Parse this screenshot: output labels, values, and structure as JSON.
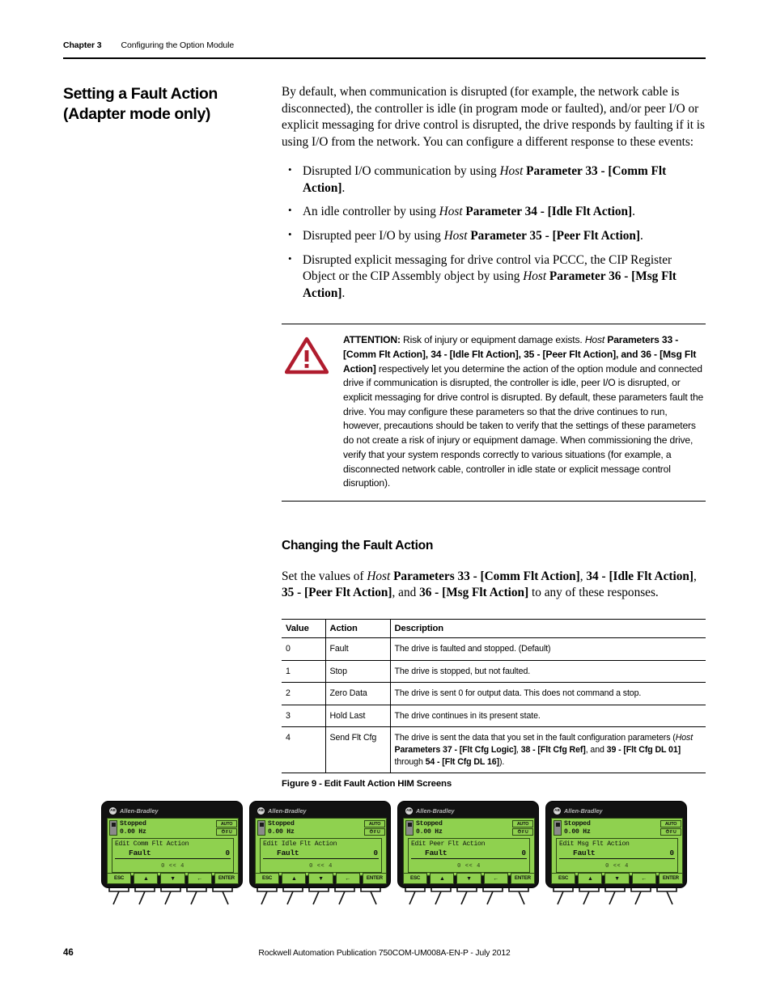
{
  "header": {
    "chapter": "Chapter 3",
    "title": "Configuring the Option Module"
  },
  "section": {
    "title_line1": "Setting a Fault Action",
    "title_line2": "(Adapter mode only)",
    "intro": "By default, when communication is disrupted (for example, the network cable is disconnected), the controller is idle (in program mode or faulted), and/or peer I/O or explicit messaging for drive control is disrupted, the drive responds by faulting if it is using I/O from the network. You can configure a different response to these events:"
  },
  "bullets": [
    {
      "pre": "Disrupted I/O communication by using ",
      "italic": "Host",
      "bold": " Parameter 33 - [Comm Flt Action]",
      "post": "."
    },
    {
      "pre": "An idle controller by using ",
      "italic": "Host",
      "bold": " Parameter 34 - [Idle Flt Action]",
      "post": "."
    },
    {
      "pre": "Disrupted peer I/O by using ",
      "italic": "Host",
      "bold": " Parameter 35 - [Peer Flt Action]",
      "post": "."
    },
    {
      "pre": "Disrupted explicit messaging for drive control via PCCC, the CIP Register Object or the CIP Assembly object by using ",
      "italic": "Host",
      "bold": " Parameter 36 - [Msg Flt Action]",
      "post": "."
    }
  ],
  "attention": {
    "icon": "warning-triangle-icon",
    "label": "ATTENTION:",
    "lead": " Risk of injury or equipment damage exists. ",
    "host": "Host",
    "params": " Parameters 33 - [Comm Flt Action], 34 - [Idle Flt Action], 35 - [Peer Flt Action], and 36 - [Msg Flt Action]",
    "body": " respectively let you determine the action of the option module and connected drive if communication is disrupted, the controller is idle, peer I/O is disrupted, or explicit messaging for drive control is disrupted. By default, these parameters fault the drive. You may configure these parameters so that the drive continues to run, however, precautions should be taken to verify that the settings of these parameters do not create a risk of injury or equipment damage. When commissioning the drive, verify that your system responds correctly to various situations (for example, a disconnected network cable, controller in idle state or explicit message control disruption).",
    "accent_color": "#b01c2e"
  },
  "subsection": {
    "title": "Changing the Fault Action",
    "intro_pre": "Set the values of ",
    "intro_italic": "Host",
    "intro_bold_1": " Parameters 33 - [Comm Flt Action]",
    "intro_mid_1": ", ",
    "intro_bold_2": "34 - [Idle Flt Action]",
    "intro_mid_2": ", ",
    "intro_bold_3": "35 - [Peer Flt Action]",
    "intro_mid_3": ", and ",
    "intro_bold_4": "36 - [Msg Flt Action]",
    "intro_post": " to any of these responses."
  },
  "table": {
    "headers": [
      "Value",
      "Action",
      "Description"
    ],
    "rows": [
      {
        "value": "0",
        "action": "Fault",
        "desc": "The drive is faulted and stopped. (Default)"
      },
      {
        "value": "1",
        "action": "Stop",
        "desc": "The drive is stopped, but not faulted."
      },
      {
        "value": "2",
        "action": "Zero Data",
        "desc": "The drive is sent 0 for output data. This does not command a stop."
      },
      {
        "value": "3",
        "action": "Hold Last",
        "desc": "The drive continues in its present state."
      },
      {
        "value": "4",
        "action": "Send Flt Cfg",
        "desc_pre": "The drive is sent the data that you set in the fault configuration parameters (",
        "desc_italic": "Host",
        "desc_bold_1": " Parameters 37 - [Flt Cfg Logic]",
        "desc_mid_1": ", ",
        "desc_bold_2": "38 - [Flt Cfg Ref]",
        "desc_mid_2": ", and ",
        "desc_bold_3": "39 - [Flt Cfg DL 01]",
        "desc_mid_3": " through ",
        "desc_bold_4": "54 - [Flt Cfg DL 16]",
        "desc_post": ")."
      }
    ]
  },
  "figure": {
    "caption": "Figure 9 - Edit Fault Action HIM Screens"
  },
  "him_screens": [
    {
      "brand_logo": "AB",
      "brand_name": "Allen-Bradley",
      "status_line1": "Stopped",
      "status_line2": "0.00 Hz",
      "badge_auto": "AUTO",
      "badge_fault": "F",
      "badge_fault_suffix": "U",
      "param_title": "Edit Comm Flt Action",
      "param_value": "Fault",
      "param_number": "0",
      "range": "0  <<  4",
      "keys": [
        "ESC",
        "▲",
        "▼",
        "←",
        "ENTER"
      ],
      "lcd_color": "#8fd14f"
    },
    {
      "brand_logo": "AB",
      "brand_name": "Allen-Bradley",
      "status_line1": "Stopped",
      "status_line2": "0.00 Hz",
      "badge_auto": "AUTO",
      "badge_fault": "F",
      "badge_fault_suffix": "U",
      "param_title": "Edit Idle Flt Action",
      "param_value": "Fault",
      "param_number": "0",
      "range": "0  <<  4",
      "keys": [
        "ESC",
        "▲",
        "▼",
        "←",
        "ENTER"
      ],
      "lcd_color": "#8fd14f"
    },
    {
      "brand_logo": "AB",
      "brand_name": "Allen-Bradley",
      "status_line1": "Stopped",
      "status_line2": "0.00 Hz",
      "badge_auto": "AUTO",
      "badge_fault": "F",
      "badge_fault_suffix": "U",
      "param_title": "Edit Peer Flt Action",
      "param_value": "Fault",
      "param_number": "0",
      "range": "0  <<  4",
      "keys": [
        "ESC",
        "▲",
        "▼",
        "←",
        "ENTER"
      ],
      "lcd_color": "#8fd14f"
    },
    {
      "brand_logo": "AB",
      "brand_name": "Allen-Bradley",
      "status_line1": "Stopped",
      "status_line2": "0.00 Hz",
      "badge_auto": "AUTO",
      "badge_fault": "F",
      "badge_fault_suffix": "U",
      "param_title": "Edit Msg Flt Action",
      "param_value": "Fault",
      "param_number": "0",
      "range": "0  <<  4",
      "keys": [
        "ESC",
        "▲",
        "▼",
        "←",
        "ENTER"
      ],
      "lcd_color": "#8fd14f"
    }
  ],
  "footer": {
    "page_number": "46",
    "publication": "Rockwell Automation Publication 750COM-UM008A-EN-P - July 2012"
  }
}
